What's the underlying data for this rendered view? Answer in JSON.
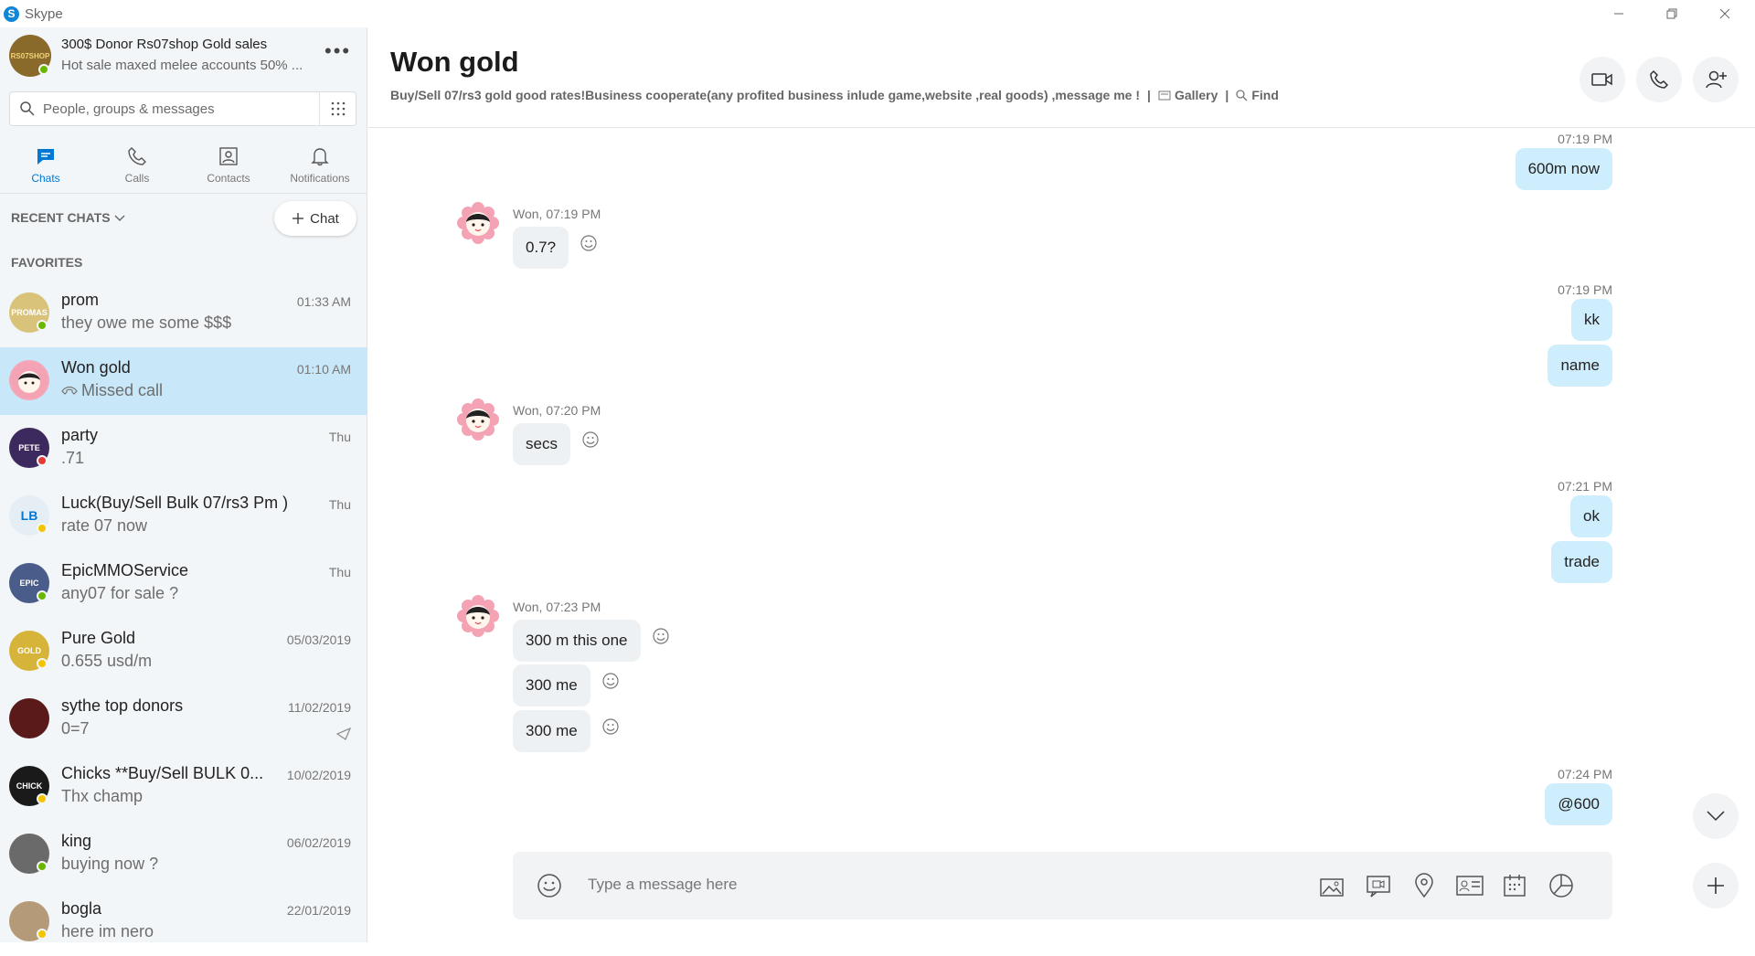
{
  "window": {
    "app_title": "Skype",
    "logo_letter": "S"
  },
  "profile": {
    "name": "300$ Donor Rs07shop  Gold sales",
    "mood": "Hot sale maxed melee accounts 50% ...",
    "avatar_text": "RS07SHOP",
    "more_label": "•••"
  },
  "search": {
    "placeholder": "People, groups & messages"
  },
  "tabs": [
    {
      "label": "Chats"
    },
    {
      "label": "Calls"
    },
    {
      "label": "Contacts"
    },
    {
      "label": "Notifications"
    }
  ],
  "recent_chats_label": "RECENT CHATS",
  "new_chat_label": "Chat",
  "favorites_label": "FAVORITES",
  "chats": [
    {
      "name": "prom",
      "preview": "they owe me some $$$",
      "time": "01:33 AM",
      "avatar_text": "PROMAS",
      "status_color": "#6bb700",
      "avatar_bg": "#d9c27a"
    },
    {
      "name": "Won gold",
      "preview": "Missed call",
      "time": "01:10 AM",
      "avatar_text": "",
      "status_color": "",
      "avatar_bg": "#f3a7b8"
    },
    {
      "name": "party",
      "preview": ".71",
      "time": "Thu",
      "avatar_text": "PETE",
      "status_color": "#e53935",
      "avatar_bg": "#3c2a5e"
    },
    {
      "name": "Luck(Buy/Sell Bulk 07/rs3 Pm )",
      "preview": "rate 07 now",
      "time": "Thu",
      "avatar_text": "LB",
      "status_color": "#f5c400",
      "avatar_bg": "#e6eef5"
    },
    {
      "name": "EpicMMOService",
      "preview": "any07 for sale ?",
      "time": "Thu",
      "avatar_text": "EPIC",
      "status_color": "#6bb700",
      "avatar_bg": "#4a5d8a"
    },
    {
      "name": "Pure Gold",
      "preview": "0.655 usd/m",
      "time": "05/03/2019",
      "avatar_text": "GOLD",
      "status_color": "#f5c400",
      "avatar_bg": "#d6b43a"
    },
    {
      "name": "sythe top donors",
      "preview": "0=7",
      "time": "11/02/2019",
      "avatar_text": "",
      "status_color": "",
      "avatar_bg": "#5a1a1a"
    },
    {
      "name": "Chicks **Buy/Sell BULK 0...",
      "preview": "Thx champ",
      "time": "10/02/2019",
      "avatar_text": "CHICK",
      "status_color": "#f5c400",
      "avatar_bg": "#1a1a1a"
    },
    {
      "name": "king",
      "preview": "buying now ?",
      "time": "06/02/2019",
      "avatar_text": "",
      "status_color": "#6bb700",
      "avatar_bg": "#6a6a6a"
    },
    {
      "name": "bogla",
      "preview": "here im nero",
      "time": "22/01/2019",
      "avatar_text": "",
      "status_color": "#f5c400",
      "avatar_bg": "#b59a7a"
    }
  ],
  "conversation": {
    "title": "Won gold",
    "subtitle": "Buy/Sell 07/rs3 gold good rates!Business cooperate(any profited business inlude game,website ,real goods) ,message me !",
    "gallery_label": "Gallery",
    "find_label": "Find",
    "separator": "|"
  },
  "messages": [
    {
      "dir": "out",
      "time": "07:19 PM",
      "texts": [
        "600m now"
      ]
    },
    {
      "dir": "in",
      "sender": "Won, 07:19 PM",
      "texts": [
        "0.7?"
      ]
    },
    {
      "dir": "out",
      "time": "07:19 PM",
      "texts": [
        "kk",
        "name"
      ]
    },
    {
      "dir": "in",
      "sender": "Won, 07:20 PM",
      "texts": [
        "secs"
      ]
    },
    {
      "dir": "out",
      "time": "07:21 PM",
      "texts": [
        "ok",
        "trade"
      ]
    },
    {
      "dir": "in",
      "sender": "Won, 07:23 PM",
      "texts": [
        "300 m this one",
        "300 me",
        "300 me"
      ]
    },
    {
      "dir": "out",
      "time": "07:24 PM",
      "texts": [
        "@600"
      ]
    }
  ],
  "composer": {
    "placeholder": "Type a message here"
  },
  "colors": {
    "accent": "#0078d4",
    "bubble_out": "#cfeefd",
    "bubble_in": "#eef1f3",
    "active_chat": "#c8e7f8"
  }
}
